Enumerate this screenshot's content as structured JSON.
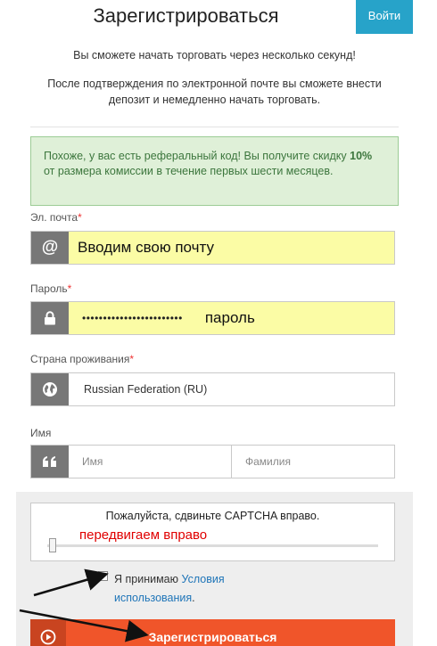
{
  "header": {
    "title": "Зарегистрироваться",
    "login_label": "Войти"
  },
  "intro": {
    "line1": "Вы сможете начать торговать через несколько секунд!",
    "line2": "После подтверждения по электронной почте вы сможете внести депозит и немедленно начать торговать."
  },
  "referral": {
    "text_before": "Похоже, у вас есть реферальный код! Вы получите скидку",
    "discount": "10%",
    "text_after": "от размера комиссии в течение первых шести месяцев."
  },
  "form": {
    "email_label": "Эл. почта",
    "email_value": "Вводим свою почту",
    "password_label": "Пароль",
    "password_value": "••••••••••••••••••••••••",
    "password_note": "пароль",
    "country_label": "Страна проживания",
    "country_value": "Russian Federation (RU)",
    "name_label": "Имя",
    "first_name_placeholder": "Имя",
    "last_name_placeholder": "Фамилия",
    "required_mark": "*",
    "at_symbol": "@"
  },
  "captcha": {
    "instruction": "Пожалуйста, сдвиньте CAPTCHA вправо.",
    "hint": "передвигаем вправо",
    "slider_position": 0
  },
  "terms": {
    "prefix": "Я принимаю",
    "link": "Условия использования",
    "suffix": "."
  },
  "submit": {
    "label": "Зарегистрироваться"
  },
  "icons": [
    "at-icon",
    "lock-icon",
    "globe-icon",
    "quote-icon",
    "play-icon"
  ],
  "colors": {
    "accent_blue": "#27a3c9",
    "submit_orange": "#f0552a",
    "autofill_yellow": "#fbfca5",
    "success_green_bg": "#dff0d8",
    "success_green_text": "#3c763d",
    "hint_red": "#e00000",
    "link_blue": "#1f75b8"
  }
}
